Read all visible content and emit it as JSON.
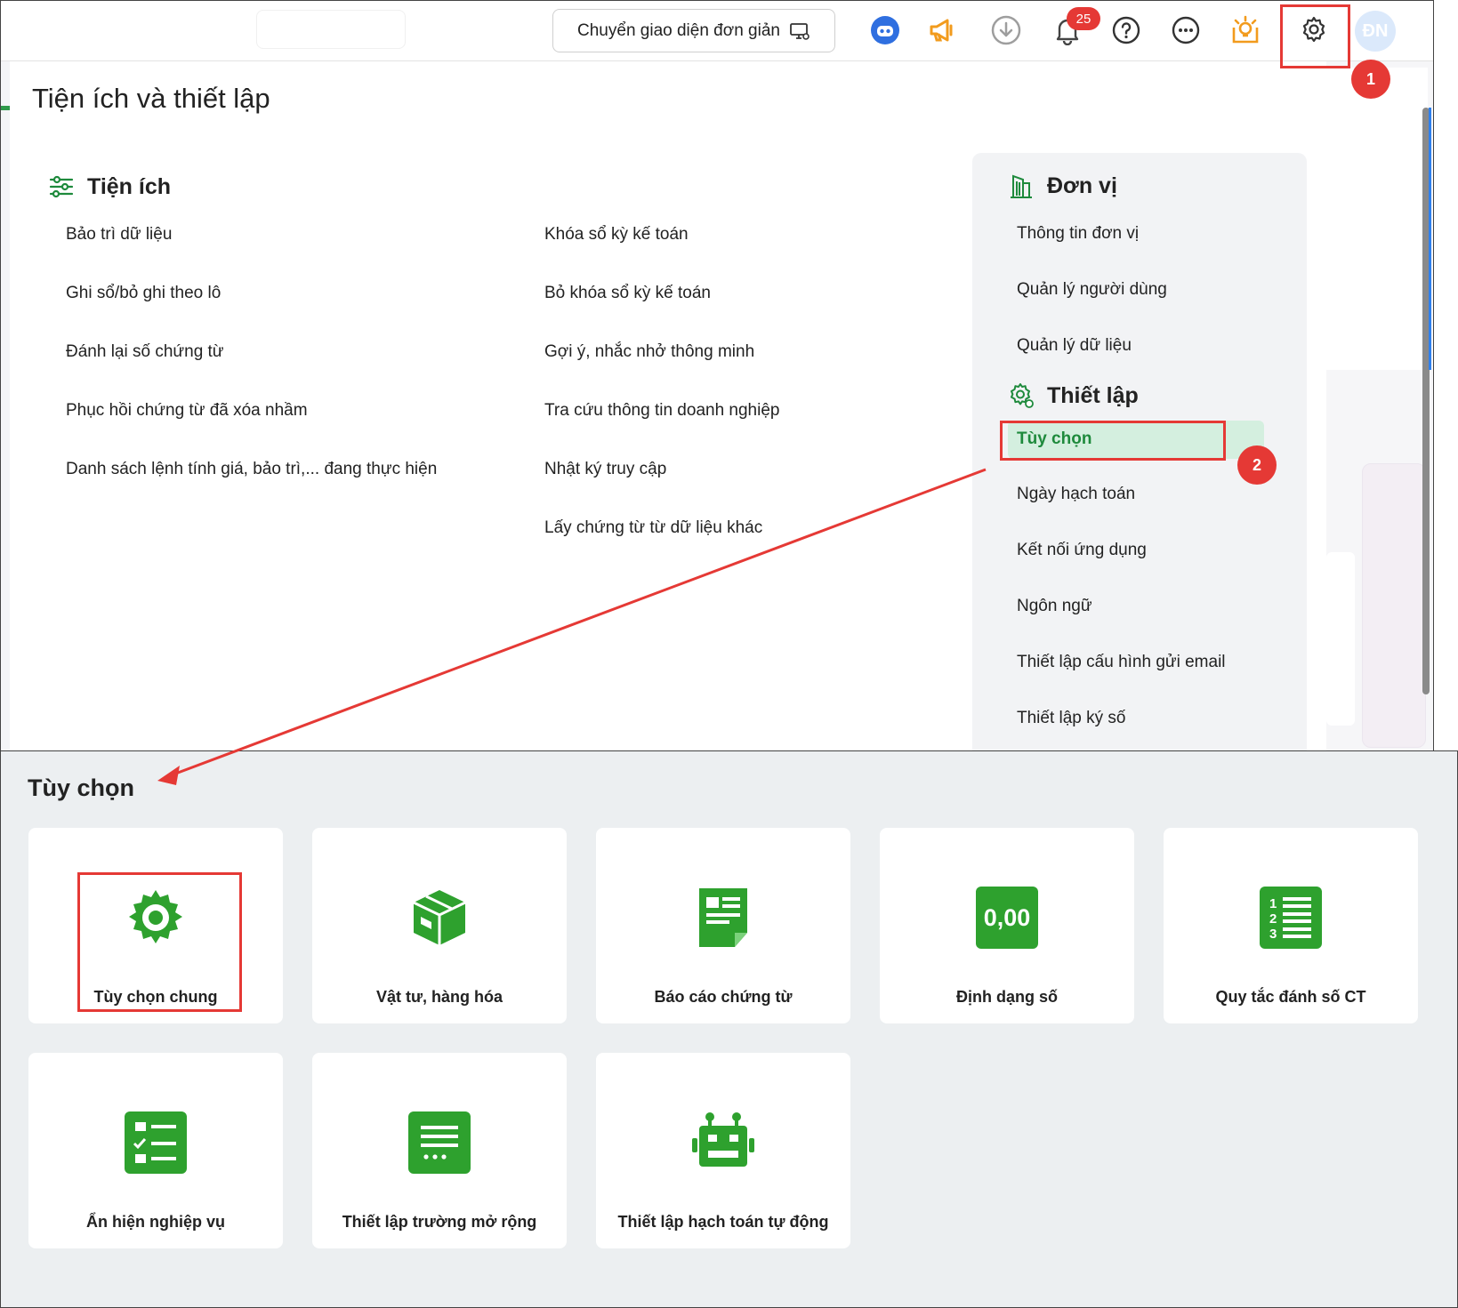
{
  "topbar": {
    "switch_button_label": "Chuyển giao diện đơn giản",
    "notification_count": "25",
    "avatar_initials": "ĐN"
  },
  "panel": {
    "title": "Tiện ích và thiết lập",
    "utilities": {
      "heading": "Tiện ích",
      "col1": [
        "Bảo trì dữ liệu",
        "Ghi sổ/bỏ ghi theo lô",
        "Đánh lại số chứng từ",
        "Phục hồi chứng từ đã xóa nhầm",
        "Danh sách lệnh tính giá, bảo trì,... đang thực hiện"
      ],
      "col2": [
        "Khóa sổ kỳ kế toán",
        "Bỏ khóa sổ kỳ kế toán",
        "Gợi ý, nhắc nhở thông minh",
        "Tra cứu thông tin doanh nghiệp",
        "Nhật ký truy cập",
        "Lấy chứng từ từ dữ liệu khác"
      ]
    },
    "unit": {
      "heading": "Đơn vị",
      "items": [
        "Thông tin đơn vị",
        "Quản lý người dùng",
        "Quản lý dữ liệu"
      ]
    },
    "setup": {
      "heading": "Thiết lập",
      "active_item": "Tùy chọn",
      "items": [
        "Ngày hạch toán",
        "Kết nối ứng dụng",
        "Ngôn ngữ",
        "Thiết lập cấu hình gửi email",
        "Thiết lập ký số"
      ]
    }
  },
  "annotations": {
    "step1": "1",
    "step2": "2",
    "color": "#e53935"
  },
  "options": {
    "title": "Tùy chọn",
    "accent_color": "#2ea12e",
    "cards": [
      {
        "label": "Tùy chọn chung",
        "icon": "gear-icon"
      },
      {
        "label": "Vật tư, hàng hóa",
        "icon": "box-icon"
      },
      {
        "label": "Báo cáo chứng từ",
        "icon": "document-icon"
      },
      {
        "label": "Định dạng số",
        "icon": "number-format-icon",
        "icon_text": "0,00"
      },
      {
        "label": "Quy tắc đánh số CT",
        "icon": "numbered-list-icon"
      },
      {
        "label": "Ẩn hiện nghiệp vụ",
        "icon": "checklist-icon"
      },
      {
        "label": "Thiết lập trường mở rộng",
        "icon": "form-fields-icon"
      },
      {
        "label": "Thiết lập hạch toán tự động",
        "icon": "robot-icon"
      }
    ]
  }
}
